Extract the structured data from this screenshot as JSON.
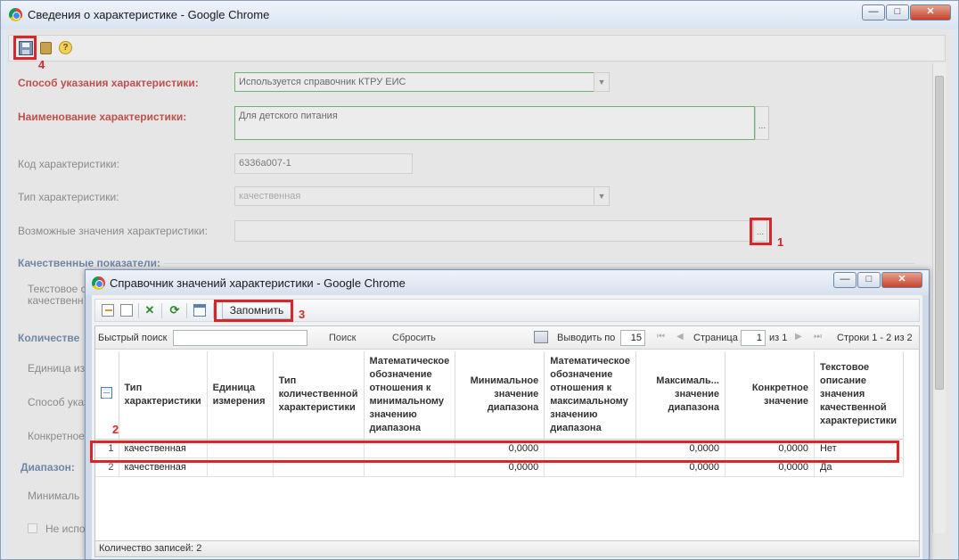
{
  "main_window": {
    "title": "Сведения о характеристике - Google Chrome",
    "controls": {
      "minimize": "—",
      "maximize": "□",
      "close": "✕"
    }
  },
  "annotations": {
    "n1": "1",
    "n2": "2",
    "n3": "3",
    "n4": "4"
  },
  "form": {
    "method_label": "Способ указания характеристики:",
    "method_value": "Используется справочник КТРУ ЕИС",
    "name_label": "Наименование характеристики:",
    "name_value": "Для детского питания",
    "name_ellipsis": "...",
    "code_label": "Код характеристики:",
    "code_value": "6336a007-1",
    "type_label": "Тип характеристики:",
    "type_value": "качественная",
    "possible_label": "Возможные значения характеристики:",
    "possible_ellipsis": "...",
    "qualitative_section": "Качественные показатели:",
    "text_desc_label_1": "Текстовое о",
    "text_desc_label_2": "качественн",
    "quantitative_section": "Количестве",
    "unit_label": "Единица из",
    "method_short_label": "Способ указ",
    "specific_label": "Конкретное",
    "range_section": "Диапазон:",
    "min_label": "Минималь",
    "not_used_label": "Не испол",
    "dropdown_arrow": "▼"
  },
  "dialog": {
    "title": "Справочник значений характеристики - Google Chrome",
    "controls": {
      "minimize": "—",
      "maximize": "□",
      "close": "✕"
    },
    "remember_button": "Запомнить",
    "search": {
      "quick_search_label": "Быстрый поиск",
      "quick_search_value": "",
      "search_button": "Поиск",
      "reset_button": "Сбросить",
      "show_per_page_label": "Выводить по",
      "per_page_value": "15",
      "page_label": "Страница",
      "page_value": "1",
      "of_pages": "из 1",
      "rows_info": "Строки 1 - 2 из 2"
    },
    "columns": [
      "Тип характеристики",
      "Единица измерения",
      "Тип количественной характеристики",
      "Математическое обозначение отношения к минимальному значению диапазона",
      "Минимальное значение диапазона",
      "Математическое обозначение отношения к максимальному значению диапазона",
      "Максималь... значение диапазона",
      "Конкретное значение",
      "Текстовое описание значения качественной характеристики"
    ],
    "rows": [
      {
        "n": "1",
        "type": "качественная",
        "unit": "",
        "qtype": "",
        "min_rel": "",
        "min": "0,0000",
        "max_rel": "",
        "max": "0,0000",
        "specific": "0,0000",
        "text": "Нет"
      },
      {
        "n": "2",
        "type": "качественная",
        "unit": "",
        "qtype": "",
        "min_rel": "",
        "min": "0,0000",
        "max_rel": "",
        "max": "0,0000",
        "specific": "0,0000",
        "text": "Да"
      }
    ],
    "footer": "Количество записей: 2"
  },
  "colors": {
    "required_label": "#c0504d",
    "annotation_red": "#d9262b",
    "section_blue": "#6f86a8"
  }
}
